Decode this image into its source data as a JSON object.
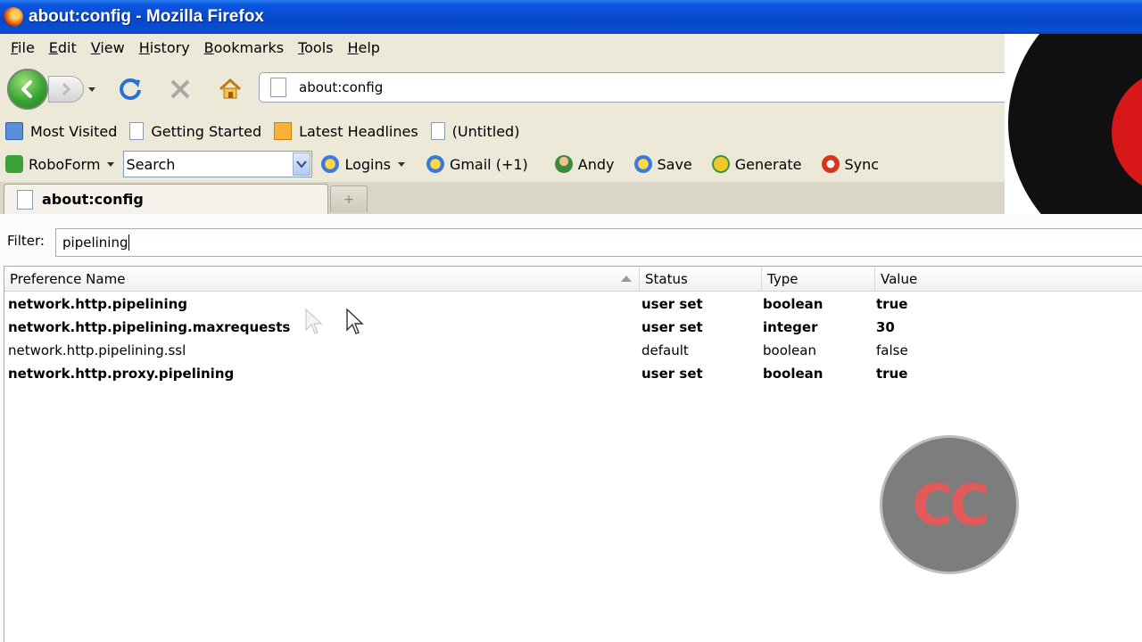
{
  "window": {
    "title": "about:config - Mozilla Firefox"
  },
  "menu": [
    "File",
    "Edit",
    "View",
    "History",
    "Bookmarks",
    "Tools",
    "Help"
  ],
  "navbar": {
    "url": "about:config",
    "icons": [
      "back-arrow-icon",
      "forward-arrow-icon",
      "reload-icon",
      "stop-icon",
      "home-icon",
      "page-icon"
    ]
  },
  "bookmarks": [
    {
      "label": "Most Visited",
      "icon": "most-visited-icon"
    },
    {
      "label": "Getting Started",
      "icon": "page-icon"
    },
    {
      "label": "Latest Headlines",
      "icon": "rss-icon"
    },
    {
      "label": "(Untitled)",
      "icon": "page-icon"
    }
  ],
  "roboform": {
    "brand": "RoboForm",
    "search_value": "Search",
    "items": [
      {
        "label": "Logins",
        "icon": "logins-icon"
      },
      {
        "label": "Gmail (+1)",
        "icon": "passcard-icon"
      },
      {
        "label": "Andy",
        "icon": "identity-icon"
      },
      {
        "label": "Save",
        "icon": "save-icon"
      },
      {
        "label": "Generate",
        "icon": "generate-icon"
      },
      {
        "label": "Sync",
        "icon": "sync-icon"
      }
    ]
  },
  "tabs": [
    {
      "label": "about:config",
      "active": true
    }
  ],
  "filter": {
    "label": "Filter:",
    "value": "pipelining"
  },
  "table": {
    "columns": [
      "Preference Name",
      "Status",
      "Type",
      "Value"
    ],
    "rows": [
      {
        "name": "network.http.pipelining",
        "status": "user set",
        "type": "boolean",
        "value": "true",
        "modified": true
      },
      {
        "name": "network.http.pipelining.maxrequests",
        "status": "user set",
        "type": "integer",
        "value": "30",
        "modified": true
      },
      {
        "name": "network.http.pipelining.ssl",
        "status": "default",
        "type": "boolean",
        "value": "false",
        "modified": false
      },
      {
        "name": "network.http.proxy.pipelining",
        "status": "user set",
        "type": "boolean",
        "value": "true",
        "modified": true
      }
    ]
  },
  "overlay": {
    "badge_text": "CC"
  },
  "colors": {
    "titlebar": "#0a56e0",
    "chrome": "#ece9d8",
    "badge_bg": "#7d7d7d",
    "badge_text": "#e25a5a"
  }
}
